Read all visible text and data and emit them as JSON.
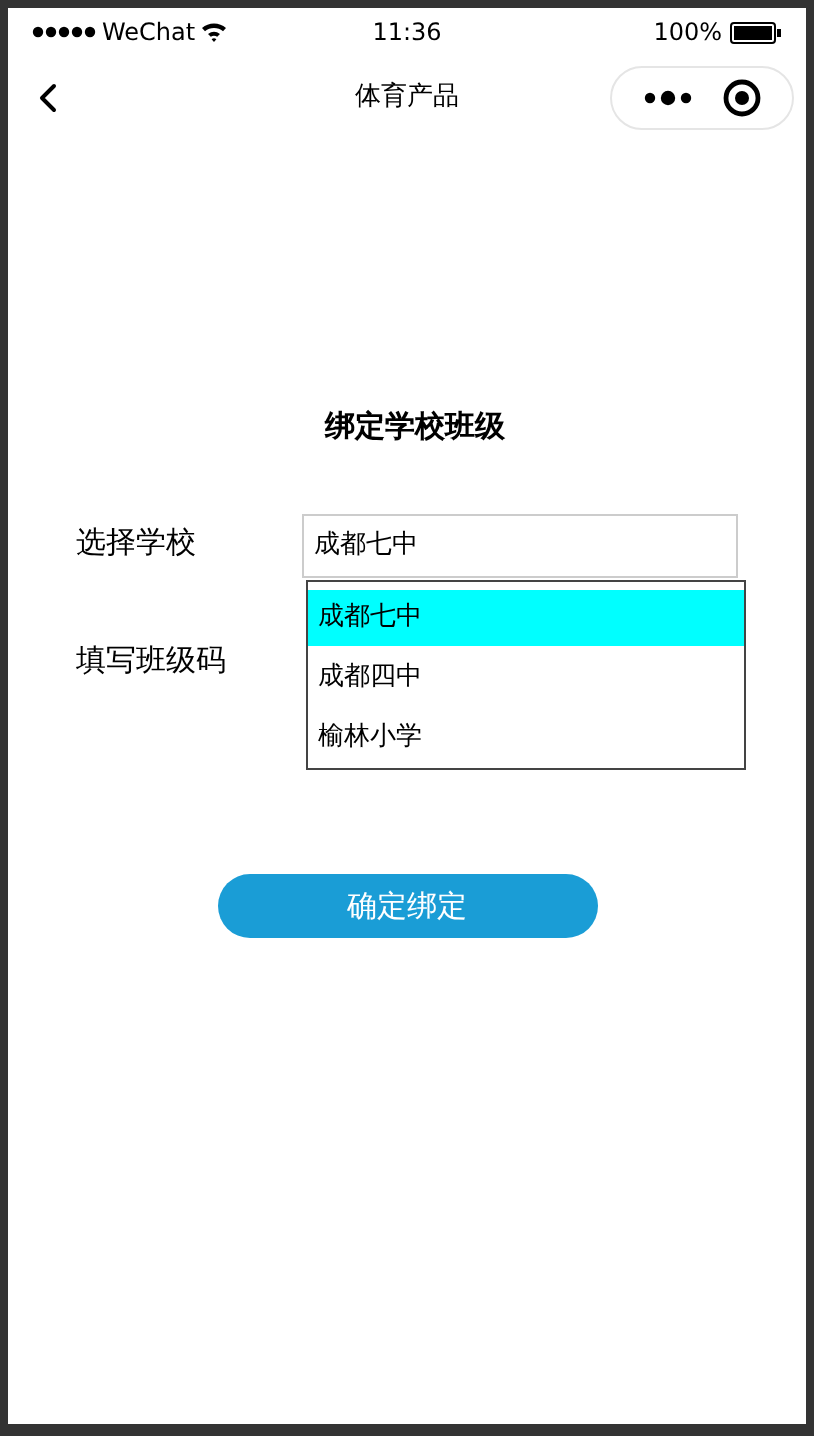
{
  "status_bar": {
    "carrier": "WeChat",
    "time": "11:36",
    "battery": "100%"
  },
  "nav_bar": {
    "title": "体育产品"
  },
  "form": {
    "title": "绑定学校班级",
    "school": {
      "label": "选择学校",
      "value": "成都七中",
      "options": [
        {
          "label": "成都七中",
          "selected": true
        },
        {
          "label": "成都四中",
          "selected": false
        },
        {
          "label": "榆林小学",
          "selected": false
        }
      ]
    },
    "class_code": {
      "label": "填写班级码"
    },
    "submit": "确定绑定"
  }
}
